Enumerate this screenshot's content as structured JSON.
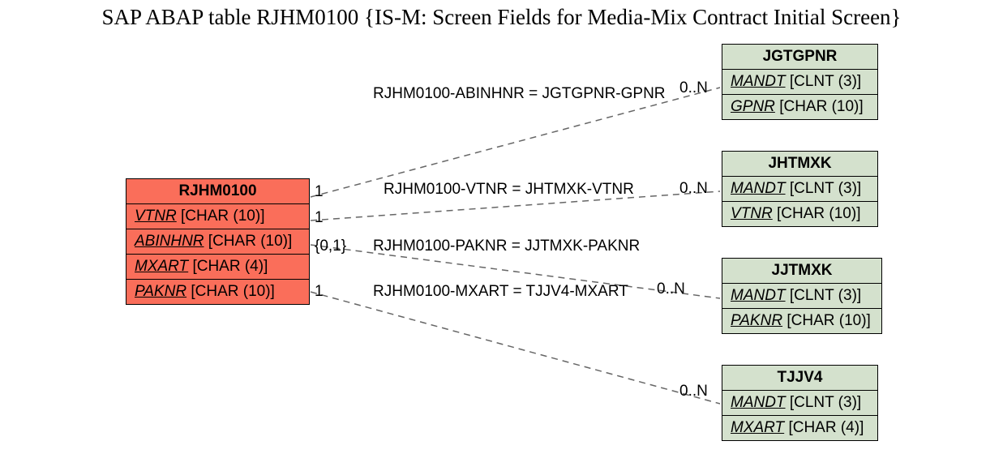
{
  "title": "SAP ABAP table RJHM0100 {IS-M: Screen Fields for Media-Mix Contract Initial Screen}",
  "main": {
    "name": "RJHM0100",
    "fields": [
      {
        "key": "VTNR",
        "type": "[CHAR (10)]"
      },
      {
        "key": "ABINHNR",
        "type": "[CHAR (10)]"
      },
      {
        "key": "MXART",
        "type": "[CHAR (4)]"
      },
      {
        "key": "PAKNR",
        "type": "[CHAR (10)]"
      }
    ]
  },
  "refs": [
    {
      "name": "JGTGPNR",
      "fields": [
        {
          "key": "MANDT",
          "type": "[CLNT (3)]"
        },
        {
          "key": "GPNR",
          "type": "[CHAR (10)]"
        }
      ]
    },
    {
      "name": "JHTMXK",
      "fields": [
        {
          "key": "MANDT",
          "type": "[CLNT (3)]"
        },
        {
          "key": "VTNR",
          "type": "[CHAR (10)]"
        }
      ]
    },
    {
      "name": "JJTMXK",
      "fields": [
        {
          "key": "MANDT",
          "type": "[CLNT (3)]"
        },
        {
          "key": "PAKNR",
          "type": "[CHAR (10)]"
        }
      ]
    },
    {
      "name": "TJJV4",
      "fields": [
        {
          "key": "MANDT",
          "type": "[CLNT (3)]"
        },
        {
          "key": "MXART",
          "type": "[CHAR (4)]"
        }
      ]
    }
  ],
  "links": [
    {
      "label": "RJHM0100-ABINHNR = JGTGPNR-GPNR",
      "leftCard": "1",
      "rightCard": "0..N"
    },
    {
      "label": "RJHM0100-VTNR = JHTMXK-VTNR",
      "leftCard": "1",
      "rightCard": "0..N"
    },
    {
      "label": "RJHM0100-PAKNR = JJTMXK-PAKNR",
      "leftCard": "{0,1}",
      "rightCard": ""
    },
    {
      "label": "RJHM0100-MXART = TJJV4-MXART",
      "leftCard": "1",
      "rightCard": "0..N"
    }
  ],
  "extraRightCard": "0..N"
}
